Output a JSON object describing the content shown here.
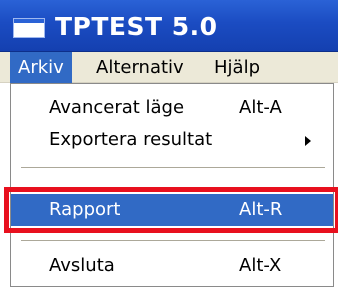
{
  "window": {
    "title": "TPTEST 5.0",
    "icon": "window-icon"
  },
  "menubar": {
    "items": [
      {
        "label": "Arkiv",
        "active": true
      },
      {
        "label": "Alternativ",
        "active": false
      },
      {
        "label": "Hjälp",
        "active": false
      }
    ]
  },
  "dropdown": {
    "items": [
      {
        "label": "Avancerat läge",
        "shortcut": "Alt-A"
      },
      {
        "label": "Exportera resultat",
        "submenu_icon": "chevron-right-icon"
      },
      {
        "label": "Rapport",
        "shortcut": "Alt-R",
        "highlighted": true
      },
      {
        "label": "Avsluta",
        "shortcut": "Alt-X"
      }
    ]
  },
  "colors": {
    "titlebar": "#1b4cc2",
    "selection": "#316ac5",
    "annotation_box": "#e8101e",
    "menu_background": "#ece9d8"
  }
}
